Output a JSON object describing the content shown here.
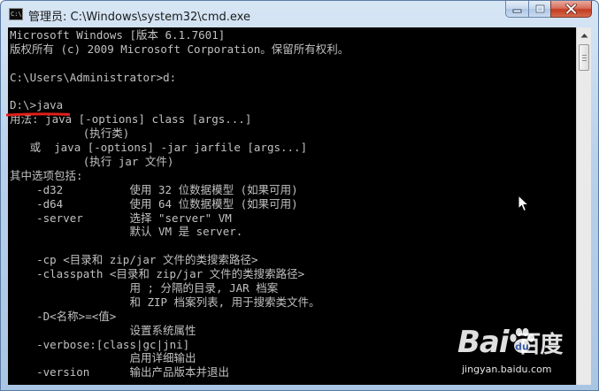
{
  "window": {
    "title": "管理员: C:\\Windows\\system32\\cmd.exe",
    "app_icon_text": "C:\\"
  },
  "console": {
    "lines": [
      "Microsoft Windows [版本 6.1.7601]",
      "版权所有 (c) 2009 Microsoft Corporation。保留所有权利。",
      "",
      "C:\\Users\\Administrator>d:",
      "",
      "D:\\>java",
      "用法: java [-options] class [args...]",
      "           (执行类)",
      "   或  java [-options] -jar jarfile [args...]",
      "           (执行 jar 文件)",
      "其中选项包括:",
      "    -d32          使用 32 位数据模型 (如果可用)",
      "    -d64          使用 64 位数据模型 (如果可用)",
      "    -server       选择 \"server\" VM",
      "                  默认 VM 是 server.",
      "",
      "    -cp <目录和 zip/jar 文件的类搜索路径>",
      "    -classpath <目录和 zip/jar 文件的类搜索路径>",
      "                  用 ; 分隔的目录, JAR 档案",
      "                  和 ZIP 档案列表, 用于搜索类文件。",
      "    -D<名称>=<值>",
      "                  设置系统属性",
      "    -verbose:[class|gc|jni]",
      "                  启用详细输出",
      "    -version      输出产品版本并退出"
    ]
  },
  "watermark": {
    "logo": "Bai  ",
    "logo_suffix": "百度",
    "sub": "jingyan.baidu.com"
  },
  "colors": {
    "console_bg": "#000000",
    "console_text": "#c0c0c0",
    "annotation": "#e0201a",
    "close_button": "#c43c22"
  },
  "icons": {
    "minimize": "minimize-icon",
    "maximize": "maximize-icon",
    "close": "close-icon",
    "scroll_up": "arrow-up-icon",
    "cursor": "mouse-pointer-icon",
    "watermark_paw": "baidu-paw-icon"
  }
}
